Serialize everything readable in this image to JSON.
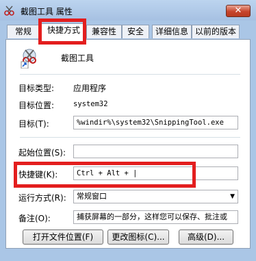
{
  "window": {
    "title": "截图工具 属性",
    "close_glyph": "✕"
  },
  "tabs": [
    {
      "label": "常规"
    },
    {
      "label": "快捷方式"
    },
    {
      "label": "兼容性"
    },
    {
      "label": "安全"
    },
    {
      "label": "详细信息"
    },
    {
      "label": "以前的版本"
    }
  ],
  "active_tab": "快捷方式",
  "shortcut": {
    "app_name": "截图工具",
    "target_type_label": "目标类型:",
    "target_type_value": "应用程序",
    "target_location_label": "目标位置:",
    "target_location_value": "system32",
    "target_label": "目标(T):",
    "target_value": "%windir%\\system32\\SnippingTool.exe",
    "start_in_label": "起始位置(S):",
    "start_in_value": "",
    "hotkey_label": "快捷键(K):",
    "hotkey_value": "Ctrl + Alt + |",
    "run_label": "运行方式(R):",
    "run_value": "常规窗口",
    "comment_label": "备注(O):",
    "comment_value": "捕获屏幕的一部分，这样您可以保存、批注或",
    "open_location_button": "打开文件位置(F)",
    "change_icon_button": "更改图标(C)...",
    "advanced_button": "高级(D)..."
  },
  "colors": {
    "highlight": "#e31e1e",
    "title_bar": "#aac6e6"
  }
}
